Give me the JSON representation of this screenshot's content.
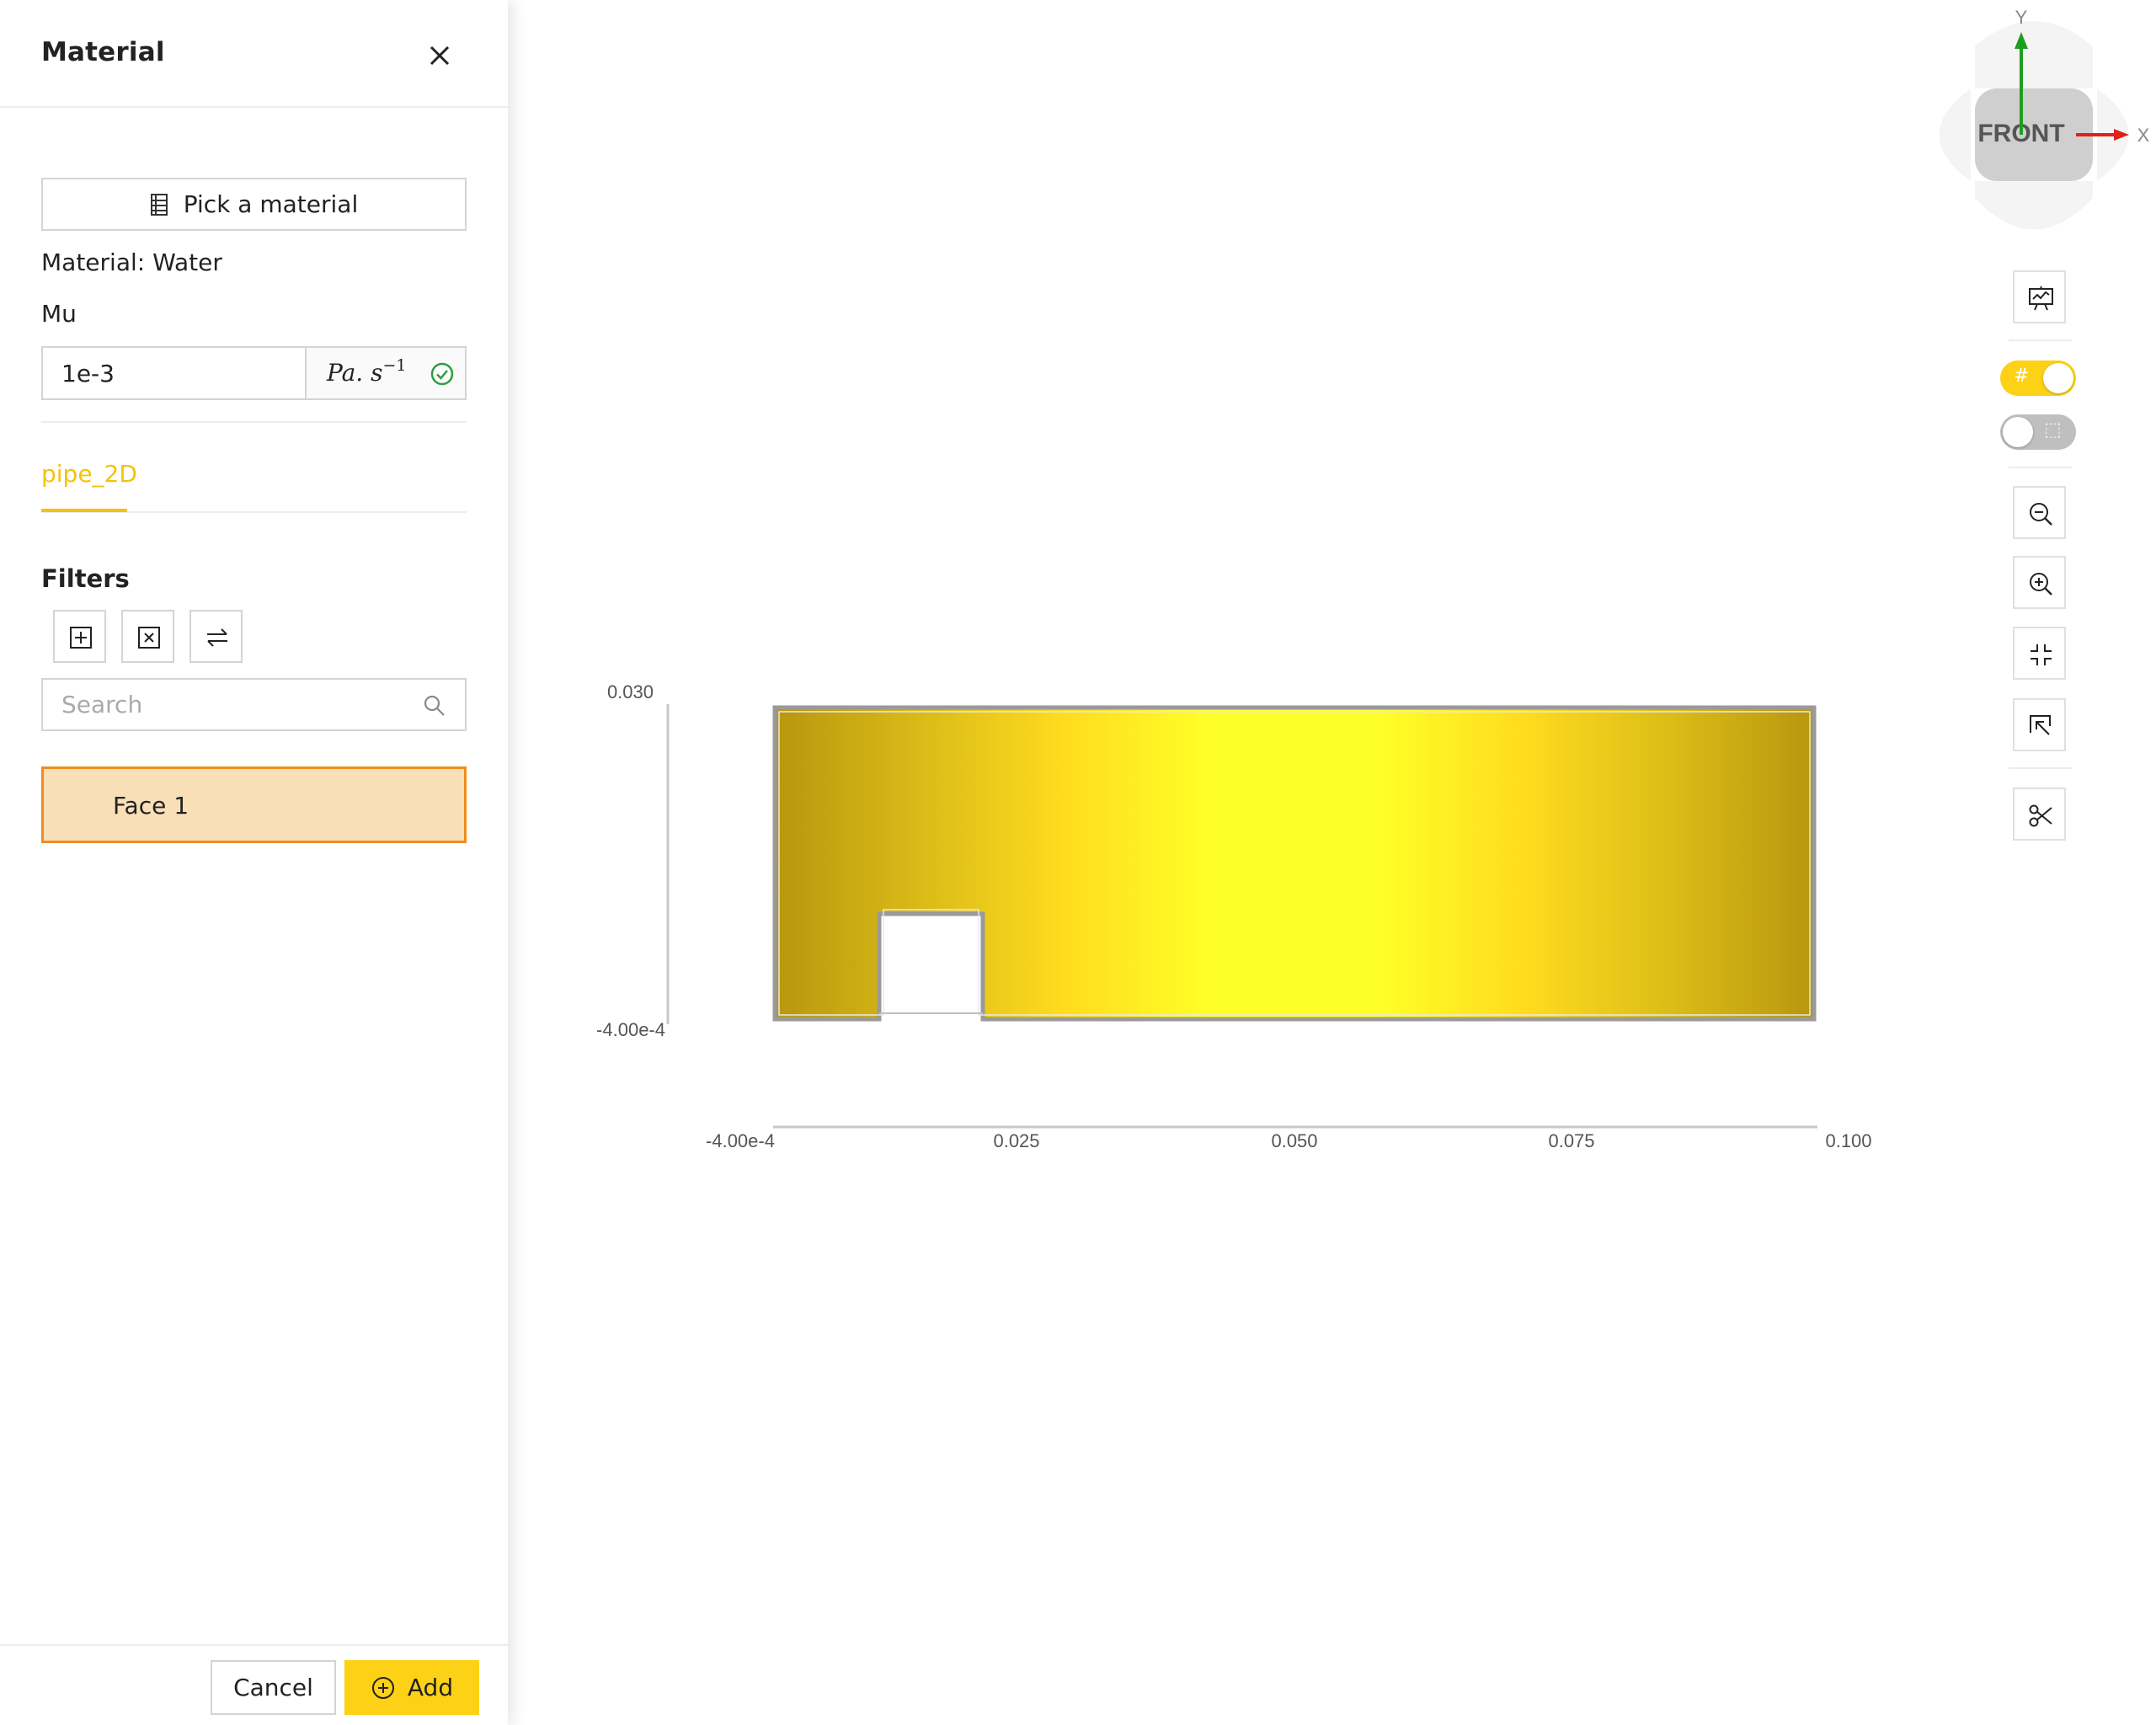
{
  "panel": {
    "title": "Material",
    "pick_button_label": "Pick a material",
    "material_text": "Material: Water",
    "property_label": "Mu",
    "mu_value": "1e-3",
    "mu_unit_base": "Pa. s",
    "mu_unit_exponent": "−1",
    "tab_label": "pipe_2D",
    "filters_title": "Filters",
    "search_placeholder": "Search",
    "items": [
      {
        "label": "Face 1",
        "selected": true
      }
    ],
    "cancel_label": "Cancel",
    "add_label": "Add"
  },
  "viewer": {
    "view_cube": {
      "face_label": "FRONT",
      "axis_y": "Y",
      "axis_x": "X"
    },
    "toggles": {
      "grid_enabled": true,
      "outline_enabled": false
    }
  },
  "axes": {
    "y_ticks": [
      "0.030",
      "-4.00e-4"
    ],
    "x_ticks": [
      "-4.00e-4",
      "0.025",
      "0.050",
      "0.075",
      "0.100"
    ]
  },
  "colors": {
    "accent": "#fcd116",
    "tab_active": "#f5c20b",
    "selected_item_bg": "#f9dfb8",
    "selected_item_border": "#f08c1f",
    "axis_y": "#1e9e1e",
    "axis_x": "#e0201b",
    "field_edge": "#b8960f",
    "field_center": "#ffff28"
  }
}
